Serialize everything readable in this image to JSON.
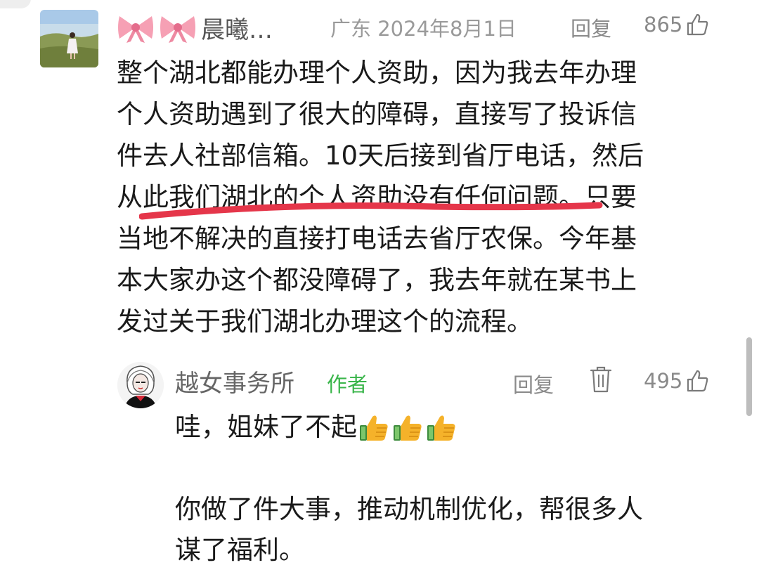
{
  "comment": {
    "username": "晨曦…",
    "location": "广东",
    "date": "2024年8月1日",
    "reply_label": "回复",
    "likes": "865",
    "lines": [
      "整个湖北都能办理个人资助，因为我去年办理",
      "个人资助遇到了很大的障碍，直接写了投诉信",
      "件去人社部信箱。10天后接到省厅电话，然后",
      "从此我们湖北的个人资助没有任何问题。只要",
      "当地不解决的直接打电话去省厅农保。今年基",
      "本大家办这个都没障碍了，我去年就在某书上",
      "发过关于我们湖北办理这个的流程。"
    ]
  },
  "reply": {
    "username": "越女事务所",
    "author_tag": "作者",
    "reply_label": "回复",
    "likes": "495",
    "first_line": "哇，姐妹了不起",
    "emoji_count": 3,
    "lines": [
      "你做了件大事，推动机制优化，帮很多人",
      "谋了福利。"
    ]
  },
  "icons": {
    "like": "thumbs-up-outline-icon",
    "delete": "trash-icon",
    "emoji": "thumbs-up-emoji",
    "bow": "pink-bow-emoji"
  },
  "colors": {
    "author_tag": "#39b54a",
    "highlight_underline": "#e5364a",
    "meta_text": "#8a8a8a"
  }
}
